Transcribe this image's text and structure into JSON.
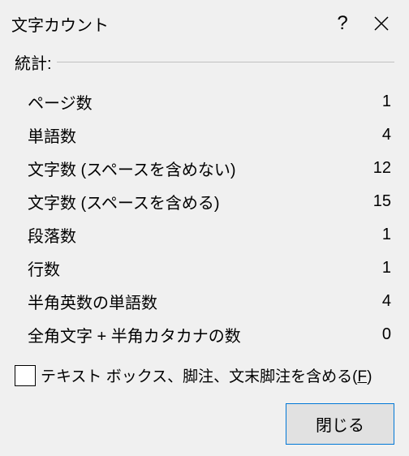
{
  "title": "文字カウント",
  "titlebar": {
    "help_label": "?",
    "close_label": "×"
  },
  "group_label": "統計:",
  "stats": [
    {
      "label": "ページ数",
      "value": "1"
    },
    {
      "label": "単語数",
      "value": "4"
    },
    {
      "label": "文字数 (スペースを含めない)",
      "value": "12"
    },
    {
      "label": "文字数 (スペースを含める)",
      "value": "15"
    },
    {
      "label": "段落数",
      "value": "1"
    },
    {
      "label": "行数",
      "value": "1"
    },
    {
      "label": "半角英数の単語数",
      "value": "4"
    },
    {
      "label": "全角文字 + 半角カタカナの数",
      "value": "0"
    }
  ],
  "checkbox": {
    "checked": false,
    "label_prefix": "テキスト ボックス、脚注、文末脚注を含める(",
    "label_accel": "F",
    "label_suffix": ")"
  },
  "footer": {
    "close_label": "閉じる"
  }
}
